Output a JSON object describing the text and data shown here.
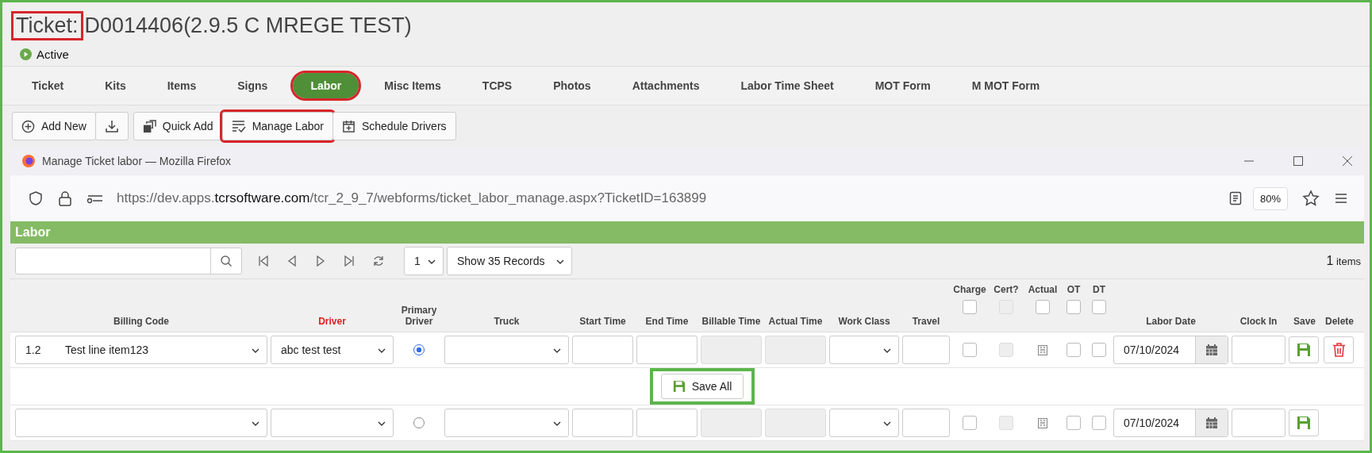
{
  "ticket": {
    "label": "Ticket:",
    "label_highlighted": true,
    "number": "D0014406(2.9.5 C MREGE TEST)",
    "status": "Active"
  },
  "tabs": [
    {
      "label": "Ticket",
      "selected": false,
      "highlighted": false
    },
    {
      "label": "Kits",
      "selected": false,
      "highlighted": false
    },
    {
      "label": "Items",
      "selected": false,
      "highlighted": false
    },
    {
      "label": "Signs",
      "selected": false,
      "highlighted": false
    },
    {
      "label": "Labor",
      "selected": true,
      "highlighted": true
    },
    {
      "label": "Misc Items",
      "selected": false,
      "highlighted": false
    },
    {
      "label": "TCPS",
      "selected": false,
      "highlighted": false
    },
    {
      "label": "Photos",
      "selected": false,
      "highlighted": false
    },
    {
      "label": "Attachments",
      "selected": false,
      "highlighted": false
    },
    {
      "label": "Labor Time Sheet",
      "selected": false,
      "highlighted": false
    },
    {
      "label": "MOT Form",
      "selected": false,
      "highlighted": false
    },
    {
      "label": "M MOT Form",
      "selected": false,
      "highlighted": false
    }
  ],
  "toolbar": [
    {
      "kind": "add",
      "label": "Add New",
      "highlighted": false
    },
    {
      "kind": "download",
      "highlighted": false
    },
    {
      "kind": "quick",
      "label": "Quick Add",
      "highlighted": false
    },
    {
      "kind": "manage",
      "label": "Manage Labor",
      "highlighted": true
    },
    {
      "kind": "schedule",
      "label": "Schedule Drivers",
      "highlighted": false
    }
  ],
  "popup": {
    "title": "Manage Ticket labor — Mozilla Firefox",
    "url_start": "https://dev.apps.",
    "url_domain": "tcrsoftware.com",
    "url_rest": "/tcr_2_9_7/webforms/ticket_labor_manage.aspx?TicketID=163899",
    "zoom": "80%"
  },
  "grid": {
    "title": "Labor",
    "page": "1",
    "page_size": "Show 35 Records",
    "item_count": "1",
    "item_unit": "items",
    "columns": [
      {
        "label": "Billing Code",
        "kind": "text",
        "required": false
      },
      {
        "label": "Driver",
        "kind": "text",
        "required": true
      },
      {
        "label": "Primary Driver",
        "kind": "text",
        "required": false
      },
      {
        "label": "Truck",
        "kind": "text",
        "required": false
      },
      {
        "label": "Start Time",
        "kind": "text",
        "required": false
      },
      {
        "label": "End Time",
        "kind": "text",
        "required": false
      },
      {
        "label": "Billable Time",
        "kind": "text",
        "required": false
      },
      {
        "label": "Actual Time",
        "kind": "text",
        "required": false
      },
      {
        "label": "Work Class",
        "kind": "text",
        "required": false
      },
      {
        "label": "Travel",
        "kind": "text",
        "required": false
      },
      {
        "label": "Charge",
        "kind": "check",
        "required": false,
        "disabled": false
      },
      {
        "label": "Cert?",
        "kind": "check",
        "required": false,
        "disabled": true
      },
      {
        "label": "Actual",
        "kind": "check",
        "required": false,
        "disabled": false
      },
      {
        "label": "OT",
        "kind": "check",
        "required": false,
        "disabled": false
      },
      {
        "label": "DT",
        "kind": "check",
        "required": false,
        "disabled": false
      },
      {
        "label": "Labor Date",
        "kind": "text",
        "required": false
      },
      {
        "label": "Clock In",
        "kind": "text",
        "required": false
      },
      {
        "label": "Save",
        "kind": "text",
        "required": false
      },
      {
        "label": "Delete",
        "kind": "text",
        "required": false
      }
    ],
    "rows": [
      {
        "code": "1.2",
        "code_name": "Test line item123",
        "driver": "abc test test",
        "primary": true,
        "labor_date": "07/10/2024",
        "deletable": true
      },
      {
        "primary": false,
        "labor_date": "07/10/2024",
        "deletable": false
      }
    ],
    "save_all": {
      "label": "Save All",
      "highlighted": true
    }
  }
}
